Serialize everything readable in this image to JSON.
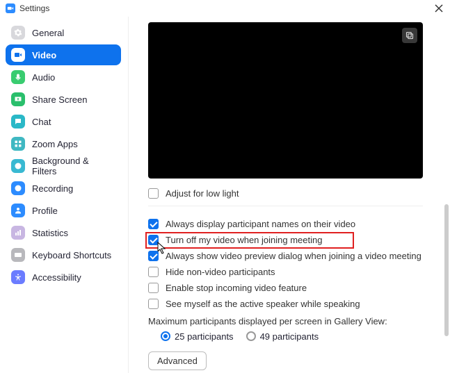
{
  "window": {
    "title": "Settings"
  },
  "sidebar": {
    "items": [
      {
        "label": "General",
        "icon": "gear",
        "bg": "#D8D8DC"
      },
      {
        "label": "Video",
        "icon": "video",
        "bg": "#0E72ED",
        "active": true
      },
      {
        "label": "Audio",
        "icon": "audio",
        "bg": "#39CC70"
      },
      {
        "label": "Share Screen",
        "icon": "share",
        "bg": "#2ABF6C"
      },
      {
        "label": "Chat",
        "icon": "chat",
        "bg": "#2AB8C7"
      },
      {
        "label": "Zoom Apps",
        "icon": "apps",
        "bg": "#3FB8C2"
      },
      {
        "label": "Background & Filters",
        "icon": "filters",
        "bg": "#39B9D2"
      },
      {
        "label": "Recording",
        "icon": "recording",
        "bg": "#2D8CFF"
      },
      {
        "label": "Profile",
        "icon": "profile",
        "bg": "#2D8CFF"
      },
      {
        "label": "Statistics",
        "icon": "stats",
        "bg": "#C8B6E2"
      },
      {
        "label": "Keyboard Shortcuts",
        "icon": "keyboard",
        "bg": "#B8B8BC"
      },
      {
        "label": "Accessibility",
        "icon": "accessibility",
        "bg": "#6B7CFF"
      }
    ]
  },
  "content": {
    "adjust_low_light": "Adjust for low light",
    "checks": [
      {
        "label": "Always display participant names on their video",
        "checked": true
      },
      {
        "label": "Turn off my video when joining meeting",
        "checked": true,
        "highlight": true
      },
      {
        "label": "Always show video preview dialog when joining a video meeting",
        "checked": true
      },
      {
        "label": "Hide non-video participants",
        "checked": false
      },
      {
        "label": "Enable stop incoming video feature",
        "checked": false
      },
      {
        "label": "See myself as the active speaker while speaking",
        "checked": false
      }
    ],
    "max_participants_label": "Maximum participants displayed per screen in Gallery View:",
    "radios": [
      {
        "label": "25 participants",
        "selected": true
      },
      {
        "label": "49 participants",
        "selected": false
      }
    ],
    "advanced": "Advanced"
  }
}
